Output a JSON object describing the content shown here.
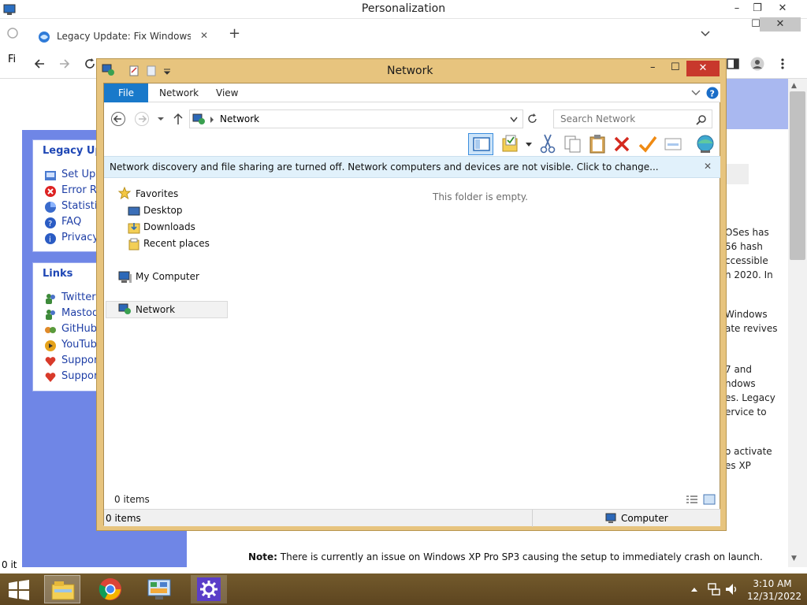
{
  "outer_window": {
    "title": "Personalization",
    "minimize": "–",
    "restore": "❐",
    "close": "✕"
  },
  "browser": {
    "tab_title": "Legacy Update: Fix Windows Updates",
    "tab_close": "✕",
    "new_tab": "+",
    "left_fragment": "Fi",
    "status_fragment": "0 it",
    "sidebar": {
      "box1_heading": "Legacy Upd",
      "box1_items": [
        "Set Up I",
        "Error Re",
        "Statistic",
        "FAQ",
        "Privacy"
      ],
      "links_heading": "Links",
      "links_items": [
        "Twitter",
        "Mastod",
        "GitHub",
        "YouTube",
        "Support",
        "Support"
      ]
    },
    "right_fragments": [
      "OSes has",
      "56 hash",
      "ccessible",
      "n 2020. In",
      "Windows",
      "ate revives",
      "7 and",
      "ndows",
      "es. Legacy",
      "ervice to",
      "o activate",
      "es XP"
    ],
    "note_label": "Note:",
    "note_text": " There is currently an issue on Windows XP Pro SP3 causing the setup to immediately crash on launch."
  },
  "explorer": {
    "title": "Network",
    "min": "–",
    "max": "☐",
    "close": "✕",
    "ribbon_tabs": {
      "file": "File",
      "network": "Network",
      "view": "View"
    },
    "address": "Network",
    "search_placeholder": "Search Network",
    "banner": "Network discovery and file sharing are turned off. Network computers and devices are not visible. Click to change...",
    "banner_close": "✕",
    "nav": {
      "favorites": "Favorites",
      "desktop": "Desktop",
      "downloads": "Downloads",
      "recent": "Recent places",
      "my_computer": "My Computer",
      "network": "Network"
    },
    "empty_message": "This folder is empty.",
    "items_count": "0 items",
    "statusbar": {
      "items": "0 items",
      "location": "Computer"
    }
  },
  "taskbar": {
    "time": "3:10 AM",
    "date": "12/31/2022"
  }
}
